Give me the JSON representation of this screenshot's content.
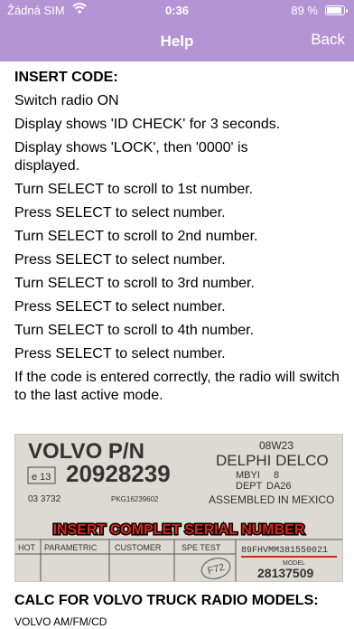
{
  "status_bar": {
    "carrier": "Žádná SIM",
    "time": "0:36",
    "battery": "89 %"
  },
  "nav": {
    "title": "Help",
    "back_label": "Back"
  },
  "instructions": {
    "heading": "INSERT CODE:",
    "lines": [
      "Switch radio ON",
      "Display shows 'ID CHECK' for 3 seconds.",
      "Display shows 'LOCK', then '0000' is displayed.",
      "Turn SELECT to scroll to 1st number.",
      "Press SELECT to select number.",
      "Turn SELECT to scroll to 2nd number.",
      "Press SELECT to select number.",
      "Turn SELECT to scroll to 3rd number.",
      "Press SELECT to select number.",
      "Turn SELECT to scroll to 4th number.",
      "Press SELECT to select number.",
      "If the code is entered correctly, the radio will switch to the last active mode."
    ]
  },
  "label_photo": {
    "brand_pn": "VOLVO P/N",
    "part_number": "20928239",
    "box_num": "e 13",
    "small_code": "03 3732",
    "pkg": "PKG16239602",
    "date_code": "08W23",
    "maker": "DELPHI DELCO",
    "mbyi": "MBYI",
    "mbyi_val": "8",
    "dept": "DEPT",
    "dept_val": "DA26",
    "assembled": "ASSEMBLED IN MEXICO",
    "banner": "INSERT COMPLET SERIAL NUMBER",
    "cols": [
      "HOT",
      "PARAMETRIC",
      "CUSTOMER",
      "SPE TEST"
    ],
    "serial": "89FHVMM381550021",
    "stamp": "F72",
    "model_label": "MODEL",
    "model_number": "28137509"
  },
  "calc": {
    "heading": "CALC FOR VOLVO TRUCK RADIO MODELS:",
    "model": "VOLVO AM/FM/CD"
  },
  "colors": {
    "accent": "#b494d4",
    "banner_red": "#d8261c"
  }
}
